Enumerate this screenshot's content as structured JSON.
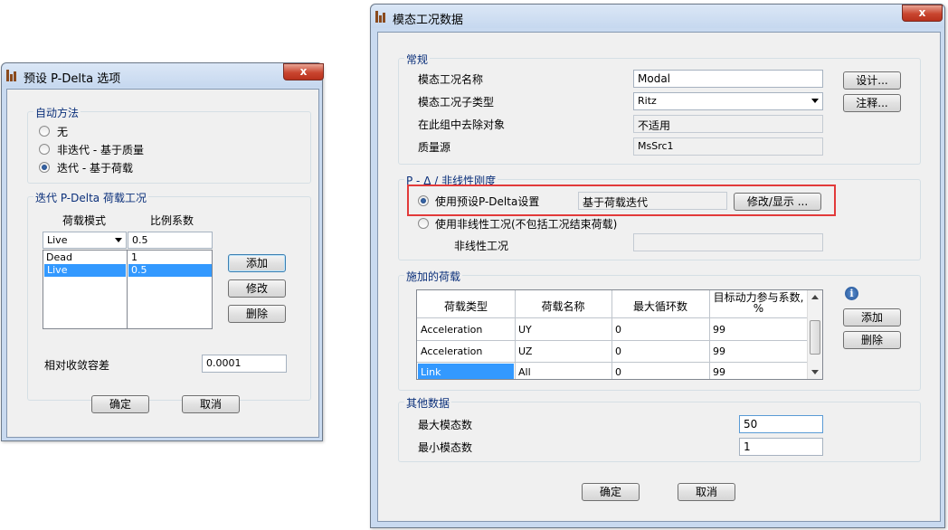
{
  "left_dialog": {
    "title": "预设 P-Delta 选项",
    "close": "x",
    "auto_method": {
      "label": "自动方法",
      "options": [
        "无",
        "非迭代 - 基于质量",
        "迭代 - 基于荷载"
      ],
      "selected": 2
    },
    "iter_group": {
      "label": "迭代 P-Delta 荷载工况",
      "col_pattern": "荷载模式",
      "col_scale": "比例系数",
      "edit_pattern": "Live",
      "edit_scale": "0.5",
      "rows": [
        {
          "pattern": "Dead",
          "scale": "1"
        },
        {
          "pattern": "Live",
          "scale": "0.5"
        }
      ],
      "selected_row": 1,
      "add": "添加",
      "modify": "修改",
      "delete": "删除",
      "tolerance_label": "相对收敛容差",
      "tolerance_value": "0.0001"
    },
    "ok": "确定",
    "cancel": "取消"
  },
  "right_dialog": {
    "title": "模态工况数据",
    "close": "x",
    "general": {
      "label": "常规",
      "case_name_label": "模态工况名称",
      "case_name": "Modal",
      "subtype_label": "模态工况子类型",
      "subtype": "Ritz",
      "exclude_label": "在此组中去除对象",
      "exclude": "不适用",
      "mass_label": "质量源",
      "mass": "MsSrc1",
      "design": "设计...",
      "notes": "注释..."
    },
    "pdelta": {
      "label": "P - Δ / 非线性刚度",
      "opt1": "使用预设P-Delta设置",
      "opt1_value": "基于荷载迭代",
      "modify_show": "修改/显示 ...",
      "opt2": "使用非线性工况(不包括工况结束荷载)",
      "nonlinear_label": "非线性工况",
      "selected": 0
    },
    "loads": {
      "label": "施加的荷载",
      "headers": [
        "荷载类型",
        "荷载名称",
        "最大循环数",
        "目标动力参与系数, %"
      ],
      "rows": [
        [
          "Acceleration",
          "UY",
          "0",
          "99"
        ],
        [
          "Acceleration",
          "UZ",
          "0",
          "99"
        ],
        [
          "Link",
          "All",
          "0",
          "99"
        ]
      ],
      "info": "i",
      "add": "添加",
      "delete": "删除"
    },
    "other": {
      "label": "其他数据",
      "max_modes_label": "最大模态数",
      "max_modes": "50",
      "min_modes_label": "最小模态数",
      "min_modes": "1"
    },
    "ok": "确定",
    "cancel": "取消"
  }
}
